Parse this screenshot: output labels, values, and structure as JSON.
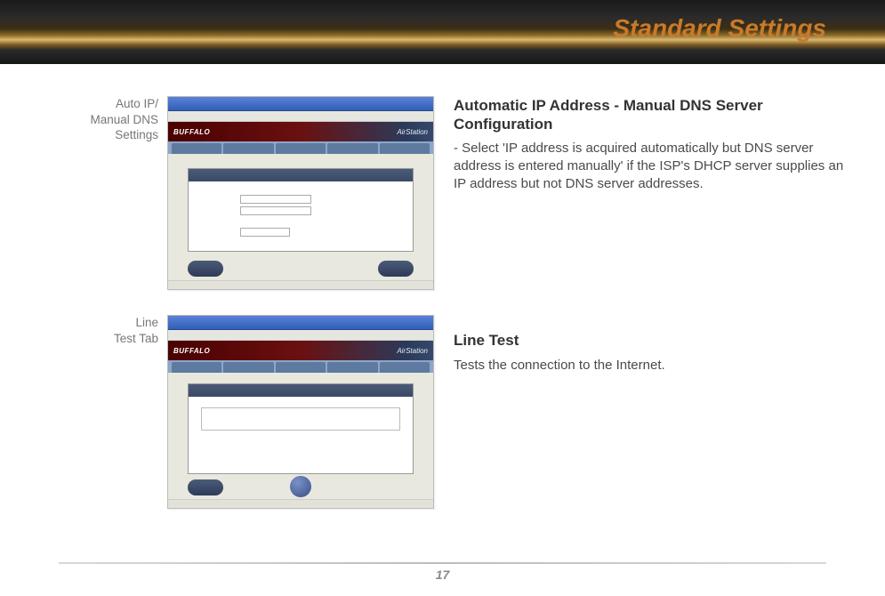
{
  "header": {
    "title": "Standard Settings"
  },
  "sections": [
    {
      "label": "Auto IP/\nManual DNS\nSettings",
      "heading": "Automatic IP Address - Manual DNS Server Configuration",
      "body": "- Select 'IP address is acquired automatically but DNS server address is entered manually' if the ISP's DHCP server supplies an IP address but not DNS server addresses."
    },
    {
      "label": "Line\nTest Tab",
      "heading": "Line Test",
      "body": "Tests the connection to the Internet."
    }
  ],
  "thumbnails": {
    "brand_left": "BUFFALO",
    "brand_right": "AirStation"
  },
  "page_number": "17"
}
